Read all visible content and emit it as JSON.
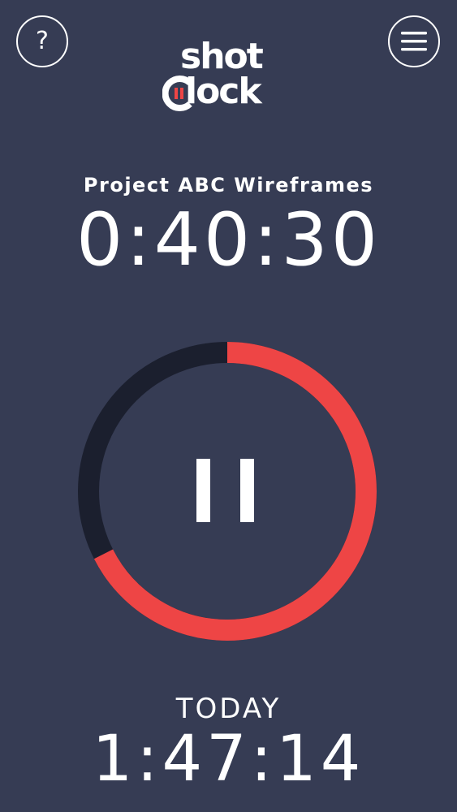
{
  "app": {
    "logo_line1": "shot",
    "logo_line2": "lock",
    "logo_accent_color": "#ee4545"
  },
  "header": {
    "help_icon": "question-mark-icon",
    "help_glyph": "?",
    "menu_icon": "hamburger-menu-icon"
  },
  "session": {
    "project_name": "Project ABC Wireframes",
    "elapsed": "0:40:30",
    "progress_fraction": 0.675,
    "state_icon": "pause-icon"
  },
  "today": {
    "label": "TODAY",
    "total": "1:47:14"
  },
  "colors": {
    "background": "#363c54",
    "ring_track": "#1b1f2e",
    "ring_progress": "#ee4545",
    "text": "#ffffff"
  }
}
